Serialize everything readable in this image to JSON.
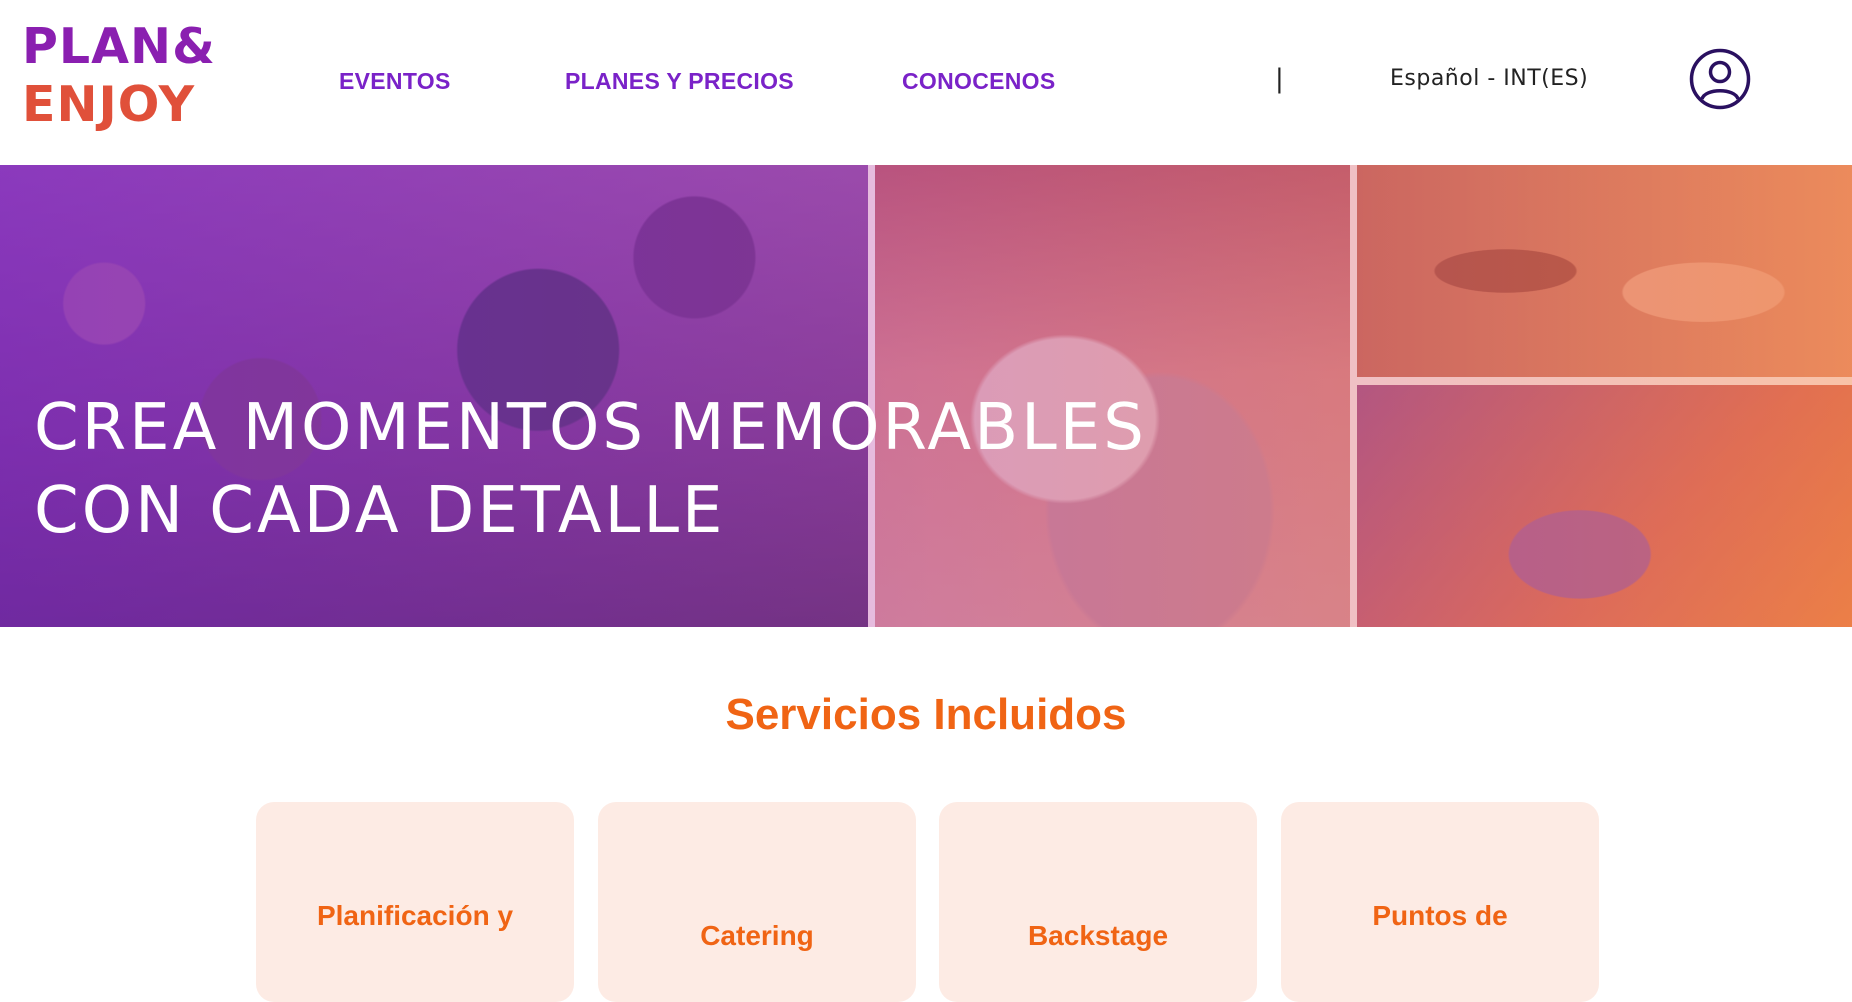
{
  "brand": {
    "line1": "PLAN&",
    "line2": "ENJOY"
  },
  "nav": {
    "items": [
      {
        "label": "EVENTOS"
      },
      {
        "label": "PLANES Y PRECIOS"
      },
      {
        "label": "CONOCENOS"
      }
    ],
    "separator": "|",
    "language": "Español - INT(ES)"
  },
  "hero": {
    "line1": "CREA MOMENTOS MEMORABLES",
    "line2": "CON CADA DETALLE"
  },
  "services": {
    "title": "Servicios Incluidos",
    "cards": [
      {
        "label": "Planificación y"
      },
      {
        "label": "Catering"
      },
      {
        "label": "Backstage"
      },
      {
        "label": "Puntos de"
      }
    ]
  },
  "colors": {
    "nav_text": "#7a22c8",
    "accent_orange": "#f06414",
    "card_bg": "#fdebe4",
    "logo_purple": "#8a1fb0",
    "logo_orange": "#e0503a"
  }
}
